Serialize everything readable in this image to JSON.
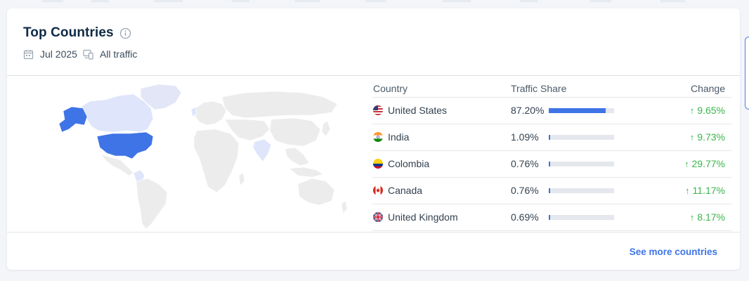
{
  "widget": {
    "title": "Top Countries",
    "date": "Jul 2025",
    "traffic_filter": "All traffic",
    "see_more": "See more countries"
  },
  "table": {
    "headers": {
      "country": "Country",
      "share": "Traffic Share",
      "change": "Change"
    },
    "rows": [
      {
        "country": "United States",
        "share": "87.20%",
        "share_value": 87.2,
        "change": "9.65%",
        "direction": "up",
        "flag": "us-flag"
      },
      {
        "country": "India",
        "share": "1.09%",
        "share_value": 1.09,
        "change": "9.73%",
        "direction": "up",
        "flag": "india-flag"
      },
      {
        "country": "Colombia",
        "share": "0.76%",
        "share_value": 0.76,
        "change": "29.77%",
        "direction": "up",
        "flag": "colombia-flag"
      },
      {
        "country": "Canada",
        "share": "0.76%",
        "share_value": 0.76,
        "change": "11.17%",
        "direction": "up",
        "flag": "canada-flag"
      },
      {
        "country": "United Kingdom",
        "share": "0.69%",
        "share_value": 0.69,
        "change": "8.17%",
        "direction": "up",
        "flag": "uk-flag"
      }
    ]
  },
  "colors": {
    "accent": "#3e74e6",
    "positive": "#3bb54a",
    "map_land": "#ececec",
    "map_highlight": "#3e74e6",
    "map_light": "#dfe6fb"
  }
}
